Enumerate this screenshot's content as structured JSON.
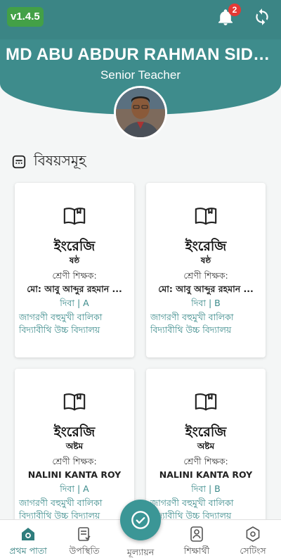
{
  "app": {
    "version": "v1.4.5",
    "notification_count": "2",
    "accent_color": "#3e8c8c"
  },
  "profile": {
    "name": "MD ABU ABDUR RAHMAN SIDDI...",
    "role": "Senior Teacher"
  },
  "section": {
    "title": "বিষয়সমূহ"
  },
  "cards": [
    {
      "subject": "ইংরেজি",
      "class": "ষষ্ঠ",
      "teacher_label": "শ্রেণী শিক্ষক:",
      "teacher": "মো: আবু আব্দুর রহমান ...",
      "shift_section": "দিবা  | A",
      "school": "জাগরণী বহুমুখী বালিকা বিদ্যাবীথি উচ্চ বিদ্যালয়"
    },
    {
      "subject": "ইংরেজি",
      "class": "ষষ্ঠ",
      "teacher_label": "শ্রেণী শিক্ষক:",
      "teacher": "মো: আবু আব্দুর রহমান ...",
      "shift_section": "দিবা  | B",
      "school": "জাগরণী বহুমুখী বালিকা বিদ্যাবীথি উচ্চ বিদ্যালয়"
    },
    {
      "subject": "ইংরেজি",
      "class": "অষ্টম",
      "teacher_label": "শ্রেণী শিক্ষক:",
      "teacher": "NALINI KANTA ROY",
      "shift_section": "দিবা  | A",
      "school": "জাগরণী বহুমুখী বালিকা বিদ্যাবীথি উচ্চ বিদ্যালয়"
    },
    {
      "subject": "ইংরেজি",
      "class": "অষ্টম",
      "teacher_label": "শ্রেণী শিক্ষক:",
      "teacher": "NALINI KANTA ROY",
      "shift_section": "দিবা  | B",
      "school": "জাগরণী বহুমুখী বালিকা বিদ্যাবীথি উচ্চ বিদ্যালয়"
    }
  ],
  "nav": {
    "items": [
      {
        "label": "প্রথম পাতা",
        "icon": "home-icon",
        "active": true
      },
      {
        "label": "উপস্থিতি",
        "icon": "attendance-icon"
      },
      {
        "label": "মূল্যায়ন",
        "icon": "evaluation-icon"
      },
      {
        "label": "শিক্ষার্থী",
        "icon": "student-icon"
      },
      {
        "label": "সেটিংস",
        "icon": "settings-icon"
      }
    ]
  }
}
